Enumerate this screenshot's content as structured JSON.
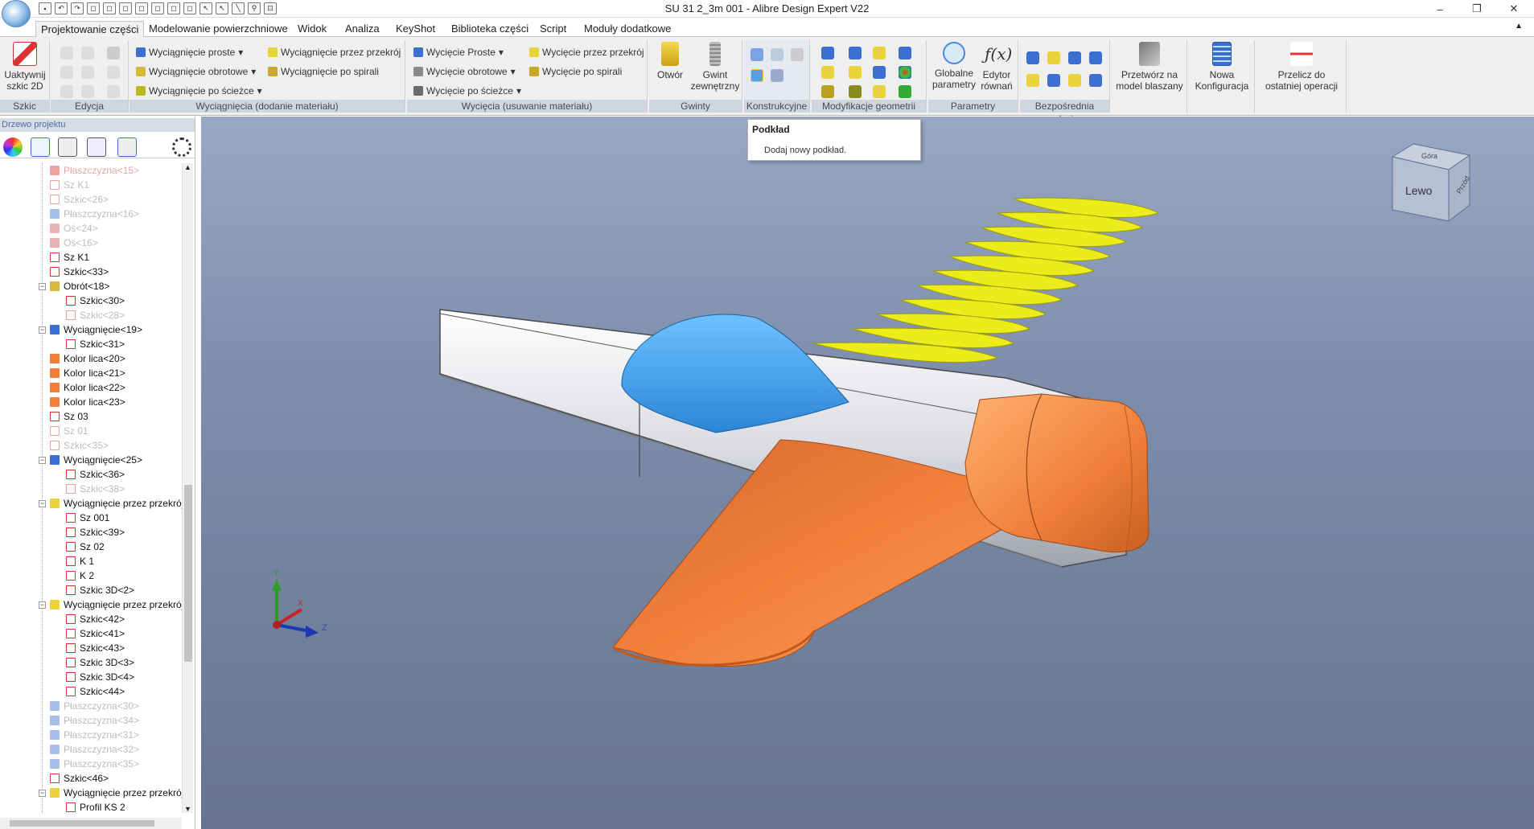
{
  "app": {
    "window_title": "SU 31 2_3m 001 - Alibre Design Expert V22",
    "window_controls": {
      "minimize": "–",
      "restore": "❐",
      "close": "✕"
    }
  },
  "menu": {
    "tabs": [
      "Projektowanie części",
      "Modelowanie powierzchniowe",
      "Widok",
      "Analiza",
      "KeyShot",
      "Biblioteka części",
      "Script",
      "Moduły dodatkowe"
    ]
  },
  "ribbon": {
    "szkic": {
      "label": "Szkic",
      "activate": "Uaktywnij szkic 2D"
    },
    "edycja": {
      "label": "Edycja"
    },
    "add": {
      "label": "Wyciągnięcia (dodanie materiału)",
      "items": [
        "Wyciągnięcie proste",
        "Wyciągnięcie obrotowe",
        "Wyciągnięcie po ścieżce",
        "Wyciągnięcie przez przekrój",
        "Wyciągnięcie po spirali"
      ]
    },
    "cut": {
      "label": "Wycięcia (usuwanie materiału)",
      "items": [
        "Wycięcie Proste",
        "Wycięcie obrotowe",
        "Wycięcie po ścieżce",
        "Wycięcie przez przekrój",
        "Wycięcie po spirali"
      ]
    },
    "gwinty": {
      "label": "Gwinty",
      "hole": "Otwór",
      "thread": "Gwint zewnętrzny"
    },
    "konstrukcyjne": {
      "label": "Konstrukcyjne"
    },
    "modyfikacje": {
      "label": "Modyfikacje geometrii"
    },
    "parametry": {
      "label": "Parametry",
      "global": "Globalne parametry",
      "equations": "Edytor równań"
    },
    "bezposrednia": {
      "label": "Bezpośrednia edycja"
    },
    "sheet": "Przetwórz na model blaszany",
    "config": "Nowa Konfiguracja",
    "recalc": "Przelicz do ostatniej operacji"
  },
  "tooltip": {
    "title": "Podkład",
    "desc": "Dodaj nowy podkład."
  },
  "panel": {
    "title": "Drzewo projektu",
    "tree": [
      {
        "label": "Płaszczyzna<15>",
        "state": "red",
        "icon": "plane-error"
      },
      {
        "label": "Sz K1",
        "state": "dim",
        "icon": "sketch"
      },
      {
        "label": "Szkic<26>",
        "state": "dim",
        "icon": "sketch"
      },
      {
        "label": "Płaszczyzna<16>",
        "state": "dim",
        "icon": "plane"
      },
      {
        "label": "Oś<24>",
        "state": "dim",
        "icon": "axis"
      },
      {
        "label": "Oś<16>",
        "state": "dim",
        "icon": "axis"
      },
      {
        "label": "Sz K1",
        "state": "",
        "icon": "sketch"
      },
      {
        "label": "Szkic<33>",
        "state": "",
        "icon": "sketch"
      },
      {
        "label": "Obrót<18>",
        "state": "",
        "icon": "revolve"
      },
      {
        "label": "Szkic<30>",
        "state": "",
        "icon": "sketch"
      },
      {
        "label": "Szkic<28>",
        "state": "dim",
        "icon": "sketch"
      },
      {
        "label": "Wyciągnięcie<19>",
        "state": "",
        "icon": "extrude"
      },
      {
        "label": "Szkic<31>",
        "state": "",
        "icon": "sketch"
      },
      {
        "label": "Kolor lica<20>",
        "state": "",
        "icon": "color"
      },
      {
        "label": "Kolor lica<21>",
        "state": "",
        "icon": "color"
      },
      {
        "label": "Kolor lica<22>",
        "state": "",
        "icon": "color"
      },
      {
        "label": "Kolor lica<23>",
        "state": "",
        "icon": "color"
      },
      {
        "label": "Sz 03",
        "state": "",
        "icon": "sketch"
      },
      {
        "label": "Sz 01",
        "state": "dim",
        "icon": "sketch"
      },
      {
        "label": "Szkic<35>",
        "state": "dim",
        "icon": "sketch"
      },
      {
        "label": "Wyciągnięcie<25>",
        "state": "",
        "icon": "extrude"
      },
      {
        "label": "Szkic<36>",
        "state": "",
        "icon": "sketch"
      },
      {
        "label": "Szkic<38>",
        "state": "dim",
        "icon": "sketch"
      },
      {
        "label": "Wyciągnięcie przez przekrój",
        "state": "",
        "icon": "loft"
      },
      {
        "label": "Sz 001",
        "state": "",
        "icon": "sketch"
      },
      {
        "label": "Szkic<39>",
        "state": "",
        "icon": "sketch"
      },
      {
        "label": "Sz 02",
        "state": "",
        "icon": "sketch"
      },
      {
        "label": "K 1",
        "state": "",
        "icon": "sketch"
      },
      {
        "label": "K 2",
        "state": "",
        "icon": "sketch3d"
      },
      {
        "label": "Szkic 3D<2>",
        "state": "",
        "icon": "sketch3d"
      },
      {
        "label": "Wyciągnięcie przez przekrój",
        "state": "",
        "icon": "loft"
      },
      {
        "label": "Szkic<42>",
        "state": "",
        "icon": "sketch"
      },
      {
        "label": "Szkic<41>",
        "state": "",
        "icon": "sketch"
      },
      {
        "label": "Szkic<43>",
        "state": "",
        "icon": "sketch"
      },
      {
        "label": "Szkic 3D<3>",
        "state": "",
        "icon": "sketch3d"
      },
      {
        "label": "Szkic 3D<4>",
        "state": "",
        "icon": "sketch3d"
      },
      {
        "label": "Szkic<44>",
        "state": "",
        "icon": "sketch"
      },
      {
        "label": "Płaszczyzna<30>",
        "state": "dim",
        "icon": "plane"
      },
      {
        "label": "Płaszczyzna<34>",
        "state": "dim",
        "icon": "plane"
      },
      {
        "label": "Płaszczyzna<31>",
        "state": "dim",
        "icon": "plane"
      },
      {
        "label": "Płaszczyzna<32>",
        "state": "dim",
        "icon": "plane"
      },
      {
        "label": "Płaszczyzna<35>",
        "state": "dim",
        "icon": "plane"
      },
      {
        "label": "Szkic<46>",
        "state": "",
        "icon": "sketch"
      },
      {
        "label": "Wyciągnięcie przez przekrój",
        "state": "",
        "icon": "loft"
      },
      {
        "label": "Profil KS 2",
        "state": "",
        "icon": "sketch"
      }
    ]
  },
  "viewcube": {
    "front": "Lewo",
    "top": "Góra",
    "side": "Przód"
  },
  "axes": {
    "y": "Y",
    "x": "X",
    "z": "Z"
  },
  "colors": {
    "fuselage": "#e9eaee",
    "canopy": "#4aa8f0",
    "wing": "#f07f3a",
    "nose": "#f07f3a",
    "sections": "#ecec1a",
    "viewport_top": "#98a8c4",
    "viewport_bottom": "#66748f"
  }
}
